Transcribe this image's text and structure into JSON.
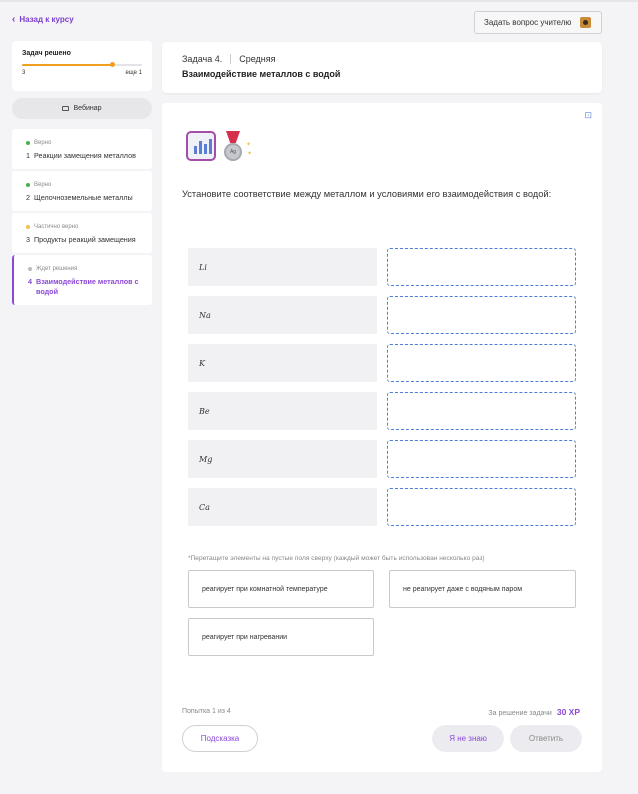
{
  "nav": {
    "back_label": "Назад к курсу",
    "ask_teacher_label": "Задать вопрос учителю"
  },
  "progress": {
    "title": "Задач решено",
    "solved": "3",
    "remaining": "еще 1",
    "fraction": 0.75,
    "accent": "#f0a020"
  },
  "webinar": {
    "label": "Вебинар"
  },
  "tasks": [
    {
      "num": "1",
      "status": "Верно",
      "status_color": "#4caf50",
      "name": "Реакции замещения металлов"
    },
    {
      "num": "2",
      "status": "Верно",
      "status_color": "#4caf50",
      "name": "Щелочноземельные металлы"
    },
    {
      "num": "3",
      "status": "Частично верно",
      "status_color": "#f2c14e",
      "name": "Продукты реакций замещения"
    },
    {
      "num": "4",
      "status": "Ждет решения",
      "status_color": "#bbbbbb",
      "name": "Взаимодействие металлов с водой"
    }
  ],
  "header": {
    "task_label": "Задача 4.",
    "difficulty": "Средняя",
    "title": "Взаимодействие металлов с водой"
  },
  "question": "Установите соответствие между металлом и условиями его взаимодействия с водой:",
  "metals": [
    "Li",
    "Na",
    "K",
    "Be",
    "Mg",
    "Ca"
  ],
  "drag_hint": "*Перетащите элементы на пустые поля сверху (каждый может быть использован несколько раз)",
  "options": [
    "реагирует при комнатной температуре",
    "не реагирует даже с водяным паром",
    "реагирует при нагревании"
  ],
  "footer": {
    "attempt": "Попытка 1 из 4",
    "reward_label": "За решение задачи",
    "reward_xp": "30 XP",
    "hint_button": "Подсказка",
    "dunno_button": "Я не знаю",
    "answer_button": "Ответить"
  },
  "colors": {
    "accent": "#8b49d6",
    "drop_border": "#4c7fd6"
  }
}
